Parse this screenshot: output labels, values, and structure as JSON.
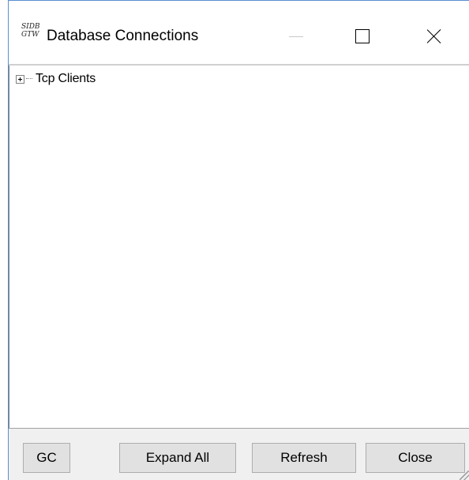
{
  "window": {
    "title": "Database Connections",
    "icon_text": [
      "SIDB",
      "GTW"
    ]
  },
  "tree": {
    "nodes": [
      {
        "label": "Tcp Clients",
        "expander": "+"
      }
    ]
  },
  "buttons": {
    "gc": "GC",
    "expand_all": "Expand All",
    "refresh": "Refresh",
    "close": "Close"
  },
  "icons": {
    "minimize": "minimize-icon",
    "maximize": "maximize-icon",
    "close": "close-icon",
    "expand": "plus-box-icon"
  },
  "colors": {
    "window_border": "#5a8fcf",
    "button_bg": "#e1e1e1",
    "dialog_bg": "#f0f0f0"
  }
}
